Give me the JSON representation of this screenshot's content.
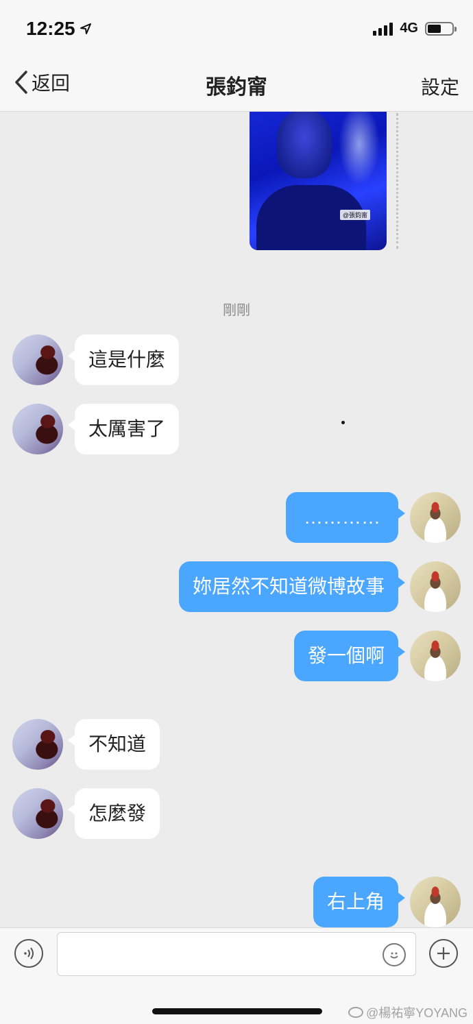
{
  "status": {
    "time": "12:25",
    "network": "4G"
  },
  "nav": {
    "back_label": "返回",
    "title": "張鈞甯",
    "settings_label": "設定"
  },
  "story": {
    "image_tag": "@張鈞甯"
  },
  "timestamp": "剛剛",
  "messages": [
    {
      "side": "in",
      "text": "這是什麼"
    },
    {
      "side": "in",
      "text": "太厲害了"
    },
    {
      "side": "out",
      "text": "…………"
    },
    {
      "side": "out",
      "text": "妳居然不知道微博故事"
    },
    {
      "side": "out",
      "text": "發一個啊"
    },
    {
      "side": "in",
      "text": "不知道"
    },
    {
      "side": "in",
      "text": "怎麼發"
    },
    {
      "side": "out",
      "text": "右上角"
    }
  ],
  "input": {
    "value": "",
    "placeholder": ""
  },
  "watermark": "@楊祐寧YOYANG",
  "colors": {
    "outgoing_bubble": "#4aa6ff",
    "incoming_bubble": "#ffffff",
    "background": "#ececec"
  }
}
